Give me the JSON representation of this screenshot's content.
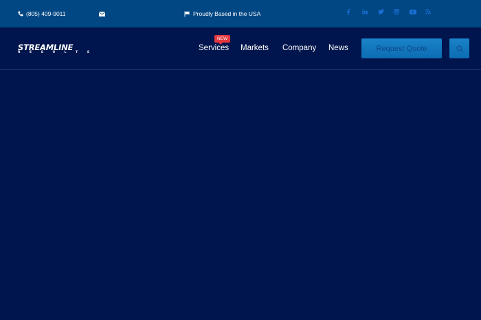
{
  "topbar": {
    "phone": "(805) 409-9011",
    "usa_text": "Proudly Based in the USA",
    "icons": [
      "phone-icon",
      "mail-icon",
      "flag-icon"
    ],
    "socials": [
      "facebook-icon",
      "linkedin-icon",
      "twitter-icon",
      "instagram-icon",
      "youtube-icon",
      "rss-icon"
    ]
  },
  "logo": {
    "main": "STREAMLINE",
    "sub": [
      "R",
      "E",
      "S",
      "U",
      "L",
      "T",
      "S"
    ]
  },
  "nav": {
    "services": "Services",
    "services_badge": "NEW",
    "markets": "Markets",
    "company": "Company",
    "news": "News",
    "quote": "Request Quote"
  },
  "colors": {
    "topbar_bg": "#014784",
    "page_bg": "#00154d",
    "accent": "#1a83c9",
    "badge": "#e5373e",
    "social": "#1a6fd6"
  }
}
